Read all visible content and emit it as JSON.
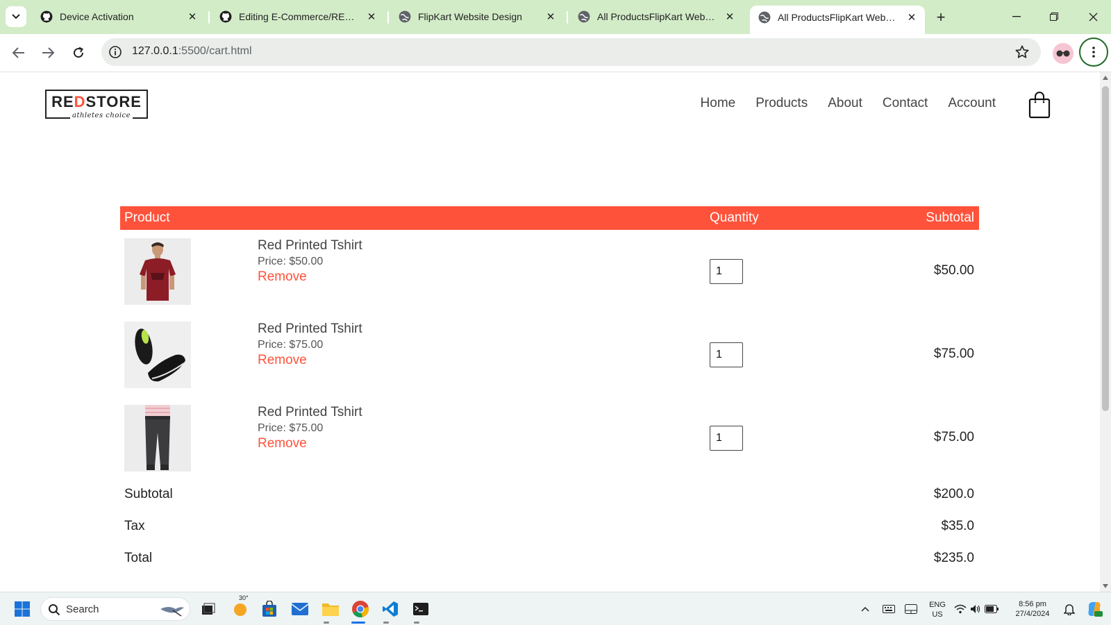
{
  "browser": {
    "tabs": [
      {
        "title": "Device Activation",
        "icon": "github-icon",
        "active": false
      },
      {
        "title": "Editing E-Commerce/README.md",
        "icon": "github-icon",
        "active": false
      },
      {
        "title": "FlipKart Website Design",
        "icon": "globe-icon",
        "active": false
      },
      {
        "title": "All ProductsFlipKart Website",
        "icon": "globe-icon",
        "active": false
      },
      {
        "title": "All ProductsFlipKart Website",
        "icon": "globe-icon",
        "active": true
      }
    ],
    "url_host": "127.0.0.1",
    "url_path": ":5500/cart.html"
  },
  "site": {
    "logo": {
      "brand_red": "RED",
      "brand_rest": "STORE",
      "brand_prefix": "RE",
      "tagline": "athletes choice"
    },
    "nav": [
      "Home",
      "Products",
      "About",
      "Contact",
      "Account"
    ]
  },
  "cart": {
    "headers": {
      "product": "Product",
      "quantity": "Quantity",
      "subtotal": "Subtotal"
    },
    "items": [
      {
        "name": "Red Printed Tshirt",
        "price": "Price: $50.00",
        "remove": "Remove",
        "qty": "1",
        "subtotal": "$50.00",
        "image": "red-tshirt"
      },
      {
        "name": "Red Printed Tshirt",
        "price": "Price: $75.00",
        "remove": "Remove",
        "qty": "1",
        "subtotal": "$75.00",
        "image": "black-shoes"
      },
      {
        "name": "Red Printed Tshirt",
        "price": "Price: $75.00",
        "remove": "Remove",
        "qty": "1",
        "subtotal": "$75.00",
        "image": "grey-joggers"
      }
    ],
    "totals": [
      {
        "label": "Subtotal",
        "value": "$200.0"
      },
      {
        "label": "Tax",
        "value": "$35.0"
      },
      {
        "label": "Total",
        "value": "$235.0"
      }
    ]
  },
  "taskbar": {
    "search_label": "Search",
    "weather_temp": "30°",
    "lang_top": "ENG",
    "lang_bottom": "US",
    "time": "8:56 pm",
    "date": "27/4/2024"
  },
  "colors": {
    "accent": "#ff523b",
    "tabbar": "#d3ecc8"
  }
}
